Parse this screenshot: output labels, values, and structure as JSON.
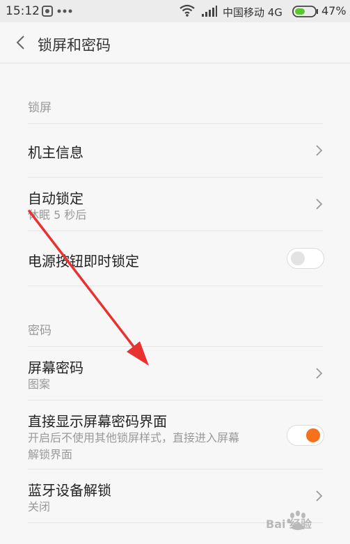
{
  "status_bar": {
    "time": "15:12",
    "carrier": "中国移动 4G",
    "battery": "47%"
  },
  "header": {
    "title": "锁屏和密码"
  },
  "sections": {
    "lock_screen": {
      "label": "锁屏",
      "owner_info": {
        "label": "机主信息"
      },
      "auto_lock": {
        "label": "自动锁定",
        "sub": "休眠 5 秒后"
      },
      "power_lock": {
        "label": "电源按钮即时锁定",
        "enabled": false
      }
    },
    "password": {
      "label": "密码",
      "screen_password": {
        "label": "屏幕密码",
        "sub": "图案"
      },
      "direct_show": {
        "label": "直接显示屏幕密码界面",
        "sub_line1": "开启后不使用其他锁屏样式，直接进入屏幕",
        "sub_line2": "解锁界面",
        "enabled": true
      },
      "bluetooth_unlock": {
        "label": "蓝牙设备解锁",
        "sub": "关闭"
      }
    }
  },
  "watermark": {
    "text": "Bai 经验",
    "logo": "baidu-paw-logo"
  },
  "colors": {
    "accent": "#f5711c",
    "annotation_arrow": "#e8322f"
  }
}
